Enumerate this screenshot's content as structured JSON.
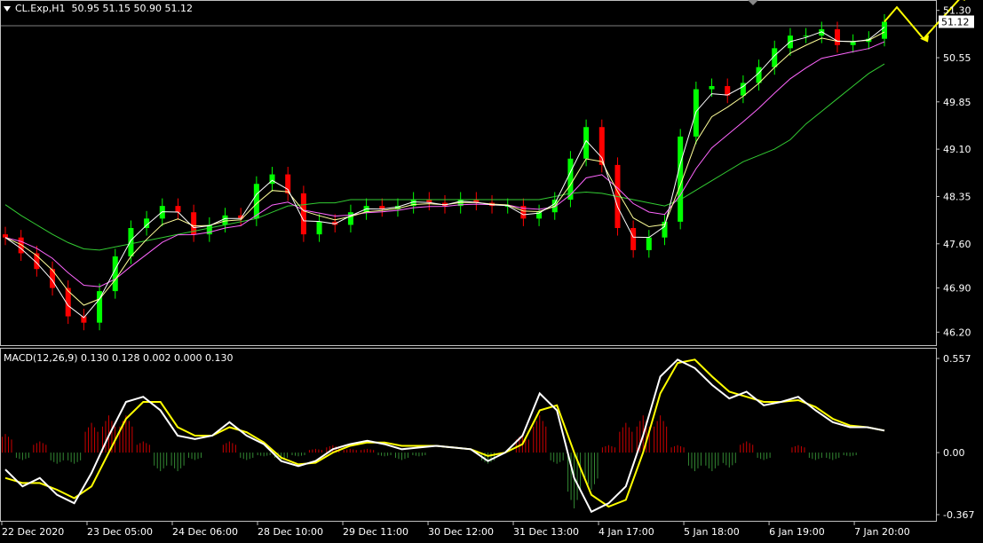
{
  "symbol_header": {
    "symbol": "CL.Exp,H1",
    "ohlc": "50.95 51.15 50.90 51.12"
  },
  "price_axis": {
    "labels": [
      "51.30",
      "50.55",
      "49.85",
      "49.10",
      "48.35",
      "47.60",
      "46.90",
      "46.20"
    ],
    "current_price": "51.12"
  },
  "macd": {
    "header": "MACD(12,26,9) 0.130 0.128 0.002 0.000 0.130",
    "axis_labels": [
      "0.557",
      "0.00",
      "-0.367"
    ]
  },
  "time_axis": {
    "labels": [
      "22 Dec 2020",
      "23 Dec 05:00",
      "24 Dec 06:00",
      "28 Dec 10:00",
      "29 Dec 11:00",
      "30 Dec 12:00",
      "31 Dec 13:00",
      "4 Jan 17:00",
      "5 Jan 18:00",
      "6 Jan 19:00",
      "7 Jan 20:00"
    ]
  },
  "colors": {
    "background": "#000000",
    "bull_candle": "#00ff00",
    "bear_candle": "#ff0000",
    "ma_fast": "#ffffff",
    "ma_mid": "#ffff99",
    "ma_slow": "#ff66ff",
    "ma_long": "#33cc33",
    "forecast_arrow": "#ffff00",
    "macd_line": "#ffffff",
    "signal_line": "#ffff00",
    "hist_up": "#cc0000",
    "hist_down": "#338833",
    "grid_border": "#c0c0c0"
  },
  "chart_data": {
    "type": "line",
    "x_labels": [
      "22 Dec 2020",
      "23 Dec 05:00",
      "24 Dec 06:00",
      "28 Dec 10:00",
      "29 Dec 11:00",
      "30 Dec 12:00",
      "31 Dec 13:00",
      "4 Jan 17:00",
      "5 Jan 18:00",
      "6 Jan 19:00",
      "7 Jan 20:00"
    ],
    "ylim": [
      46.05,
      51.38
    ],
    "close": [
      47.7,
      47.45,
      47.2,
      46.9,
      46.45,
      46.35,
      46.85,
      47.4,
      47.85,
      48.0,
      48.2,
      48.1,
      47.75,
      47.9,
      48.05,
      48.0,
      48.55,
      48.7,
      48.4,
      47.75,
      47.95,
      47.9,
      48.1,
      48.2,
      48.15,
      48.2,
      48.3,
      48.25,
      48.2,
      48.3,
      48.25,
      48.2,
      48.2,
      48.0,
      48.1,
      48.3,
      48.95,
      49.45,
      48.85,
      47.85,
      47.5,
      47.7,
      47.95,
      49.3,
      50.05,
      50.1,
      49.95,
      50.15,
      50.4,
      50.7,
      50.9,
      50.9,
      51.0,
      50.75,
      50.8,
      50.85,
      51.12
    ],
    "ma_long": [
      48.22,
      48.05,
      47.9,
      47.75,
      47.62,
      47.52,
      47.5,
      47.55,
      47.6,
      47.65,
      47.7,
      47.75,
      47.8,
      47.85,
      47.9,
      47.95,
      48.0,
      48.1,
      48.2,
      48.22,
      48.25,
      48.25,
      48.3,
      48.3,
      48.3,
      48.3,
      48.3,
      48.3,
      48.3,
      48.3,
      48.3,
      48.3,
      48.3,
      48.3,
      48.3,
      48.35,
      48.4,
      48.42,
      48.4,
      48.35,
      48.3,
      48.25,
      48.2,
      48.3,
      48.45,
      48.6,
      48.75,
      48.9,
      49.0,
      49.1,
      49.25,
      49.5,
      49.7,
      49.9,
      50.1,
      50.3,
      50.45
    ],
    "macd_ylim": [
      -0.367,
      0.557
    ],
    "macd": [
      -0.1,
      -0.2,
      -0.15,
      -0.25,
      -0.3,
      -0.12,
      0.1,
      0.3,
      0.33,
      0.25,
      0.1,
      0.08,
      0.1,
      0.18,
      0.1,
      0.05,
      -0.05,
      -0.08,
      -0.05,
      0.02,
      0.05,
      0.07,
      0.05,
      0.02,
      0.03,
      0.04,
      0.03,
      0.02,
      -0.05,
      0.0,
      0.1,
      0.35,
      0.25,
      -0.15,
      -0.35,
      -0.3,
      -0.2,
      0.1,
      0.45,
      0.55,
      0.5,
      0.4,
      0.32,
      0.36,
      0.28,
      0.3,
      0.33,
      0.25,
      0.18,
      0.15,
      0.15,
      0.13
    ],
    "signal": [
      -0.15,
      -0.18,
      -0.18,
      -0.22,
      -0.27,
      -0.2,
      0.0,
      0.2,
      0.3,
      0.3,
      0.15,
      0.1,
      0.1,
      0.15,
      0.12,
      0.06,
      -0.03,
      -0.07,
      -0.06,
      0.0,
      0.04,
      0.06,
      0.06,
      0.04,
      0.04,
      0.04,
      0.03,
      0.02,
      -0.02,
      0.0,
      0.05,
      0.25,
      0.28,
      0.0,
      -0.25,
      -0.32,
      -0.28,
      0.0,
      0.35,
      0.53,
      0.55,
      0.45,
      0.36,
      0.33,
      0.3,
      0.3,
      0.31,
      0.27,
      0.2,
      0.16,
      0.15,
      0.13
    ],
    "histogram": [
      0.05,
      -0.02,
      0.03,
      -0.03,
      -0.03,
      0.08,
      0.1,
      0.1,
      0.03,
      -0.05,
      -0.05,
      -0.02,
      0.0,
      0.03,
      -0.02,
      -0.01,
      -0.02,
      -0.01,
      0.01,
      0.02,
      0.01,
      0.01,
      -0.01,
      -0.02,
      -0.01,
      0.0,
      0.0,
      0.0,
      -0.03,
      0.0,
      0.05,
      0.1,
      -0.03,
      -0.15,
      -0.1,
      0.02,
      0.08,
      0.1,
      0.1,
      0.02,
      -0.05,
      -0.05,
      -0.04,
      0.03,
      -0.02,
      0.0,
      0.02,
      -0.02,
      -0.02,
      -0.01,
      0.0,
      0.0
    ]
  }
}
